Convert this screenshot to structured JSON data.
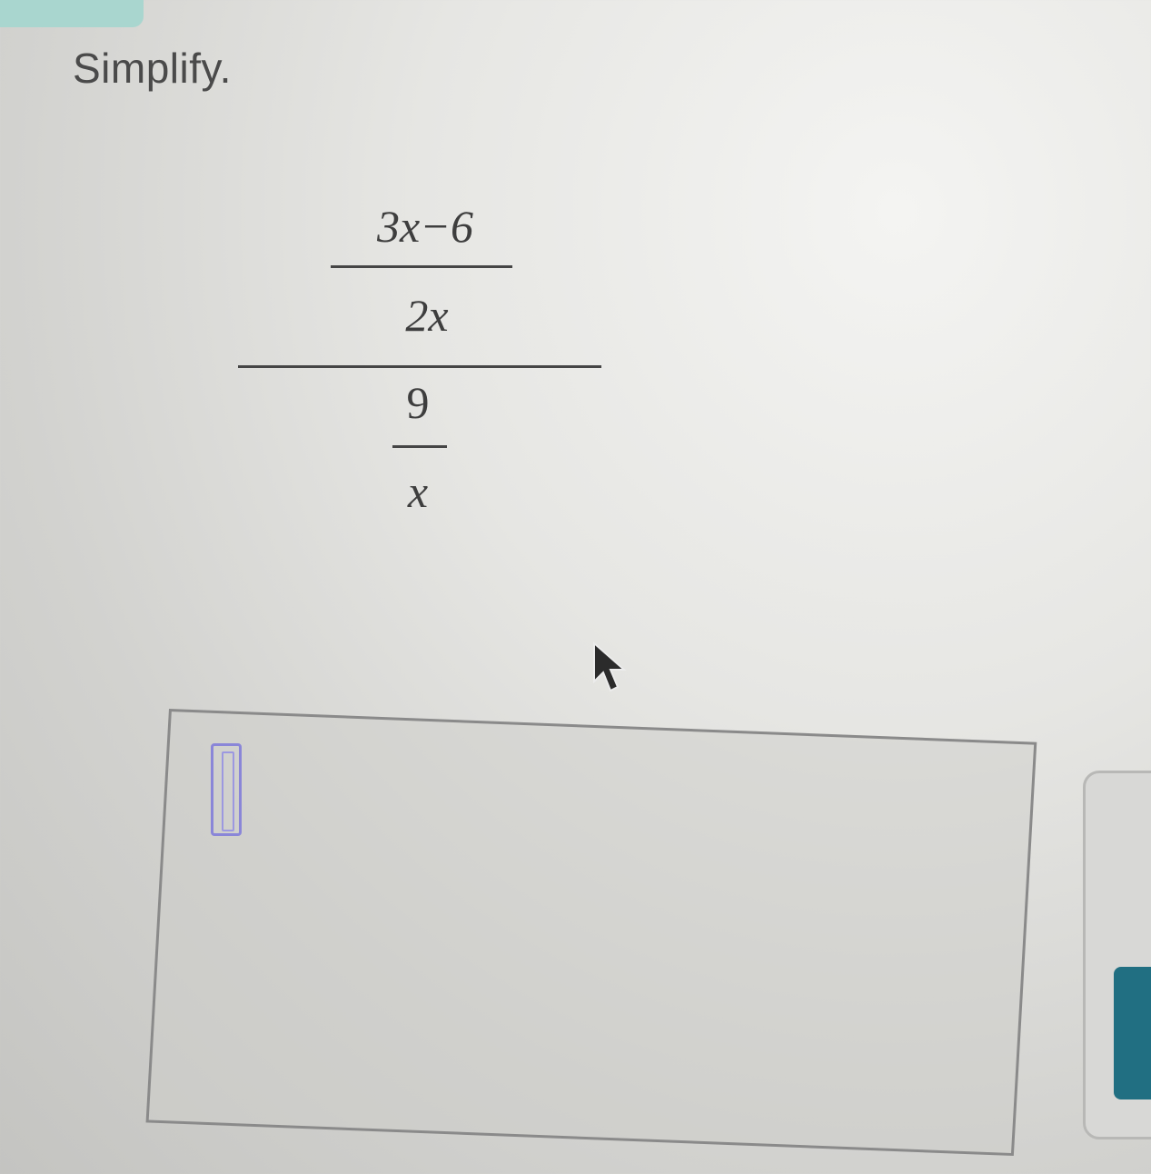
{
  "prompt": "Simplify.",
  "expression": {
    "numerator": {
      "numerator": "3x−6",
      "denominator": "2x"
    },
    "denominator": {
      "numerator": "9",
      "denominator": "x"
    }
  },
  "colors": {
    "tab": "#a9d6cf",
    "accent_button": "#216f82",
    "focus_outline": "#8a86d8"
  },
  "icons": {
    "cursor": "mouse-pointer-icon"
  }
}
